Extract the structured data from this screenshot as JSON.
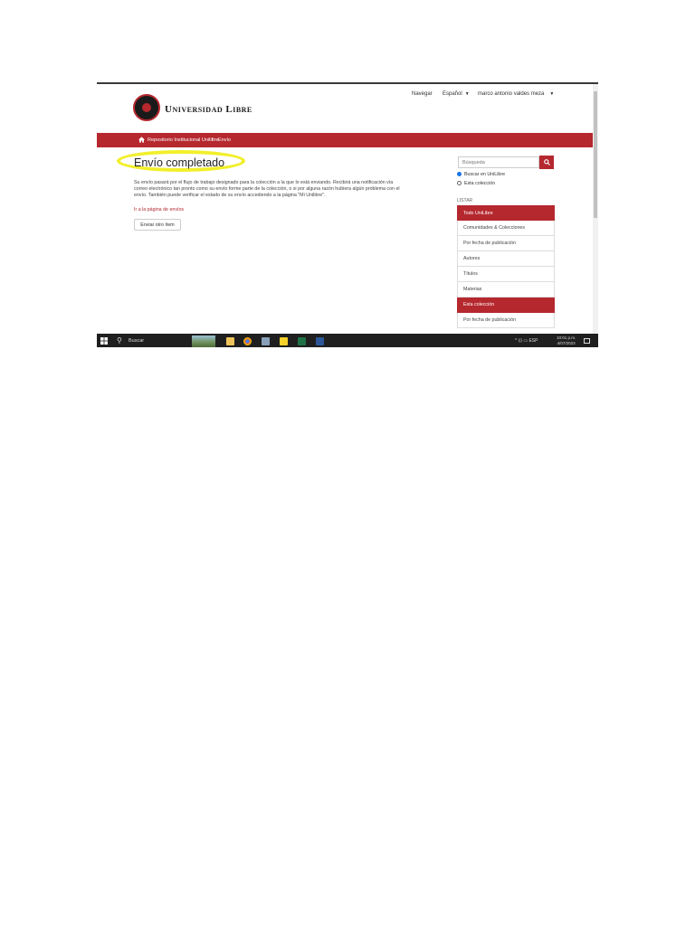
{
  "header": {
    "logo_text": "Universidad Libre",
    "nav": {
      "navegar": "Navegar",
      "language": "Español",
      "user": "marco antonio valdes meza"
    }
  },
  "breadcrumb": {
    "home": "Repositorio Institucional Unilibre",
    "separator": "/",
    "current": "Envío"
  },
  "main": {
    "title": "Envío completado",
    "message": "Su envío pasará por el flujo de trabajo designado para la colección a la que lo está enviando. Recibirá una notificación vía correo electrónico tan pronto como su envío forme parte de la colección, o si por alguna razón hubiera algún problema con el envío. También puede verificar el estado de su envío accediendo a la página \"Mi Unilibre\".",
    "return_link": "Ir a la página de envíos",
    "another_button": "Enviar otro ítem"
  },
  "sidebar": {
    "search_placeholder": "Búsqueda",
    "radios": [
      {
        "label": "Buscar en UniLibre",
        "checked": true
      },
      {
        "label": "Esta colección",
        "checked": false
      }
    ],
    "listar_label": "LISTAR",
    "menu": [
      {
        "label": "Todo UniLibre",
        "active": true
      },
      {
        "label": "Comunidades & Colecciones",
        "active": false
      },
      {
        "label": "Por fecha de publicación",
        "active": false
      },
      {
        "label": "Autores",
        "active": false
      },
      {
        "label": "Títulos",
        "active": false
      },
      {
        "label": "Materias",
        "active": false
      },
      {
        "label": "Esta colección",
        "active": true
      },
      {
        "label": "Por fecha de publicación",
        "active": false
      }
    ]
  },
  "taskbar": {
    "search": "Buscar",
    "language": "ESP",
    "time": "10:01 p.m.",
    "date": "4/07/2023"
  },
  "colors": {
    "accent": "#b5282e",
    "highlight": "#f2ef2c",
    "taskbar": "#1f1f1f"
  }
}
